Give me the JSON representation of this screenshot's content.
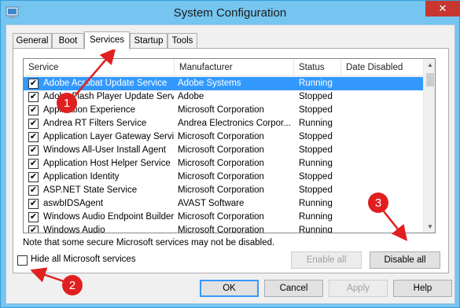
{
  "window": {
    "title": "System Configuration",
    "close_label": "✕"
  },
  "tabs": [
    {
      "label": "General"
    },
    {
      "label": "Boot"
    },
    {
      "label": "Services"
    },
    {
      "label": "Startup"
    },
    {
      "label": "Tools"
    }
  ],
  "active_tab": "Services",
  "columns": {
    "service": "Service",
    "manufacturer": "Manufacturer",
    "status": "Status",
    "date_disabled": "Date Disabled"
  },
  "services": [
    {
      "name": "Adobe Acrobat Update Service",
      "manufacturer": "Adobe Systems",
      "status": "Running",
      "date": "",
      "checked": true,
      "selected": true
    },
    {
      "name": "Adobe Flash Player Update Service",
      "manufacturer": "Adobe",
      "status": "Stopped",
      "date": "",
      "checked": true
    },
    {
      "name": "Application Experience",
      "manufacturer": "Microsoft Corporation",
      "status": "Stopped",
      "date": "",
      "checked": true
    },
    {
      "name": "Andrea RT Filters Service",
      "manufacturer": "Andrea Electronics Corpor...",
      "status": "Running",
      "date": "",
      "checked": true
    },
    {
      "name": "Application Layer Gateway Service",
      "manufacturer": "Microsoft Corporation",
      "status": "Stopped",
      "date": "",
      "checked": true
    },
    {
      "name": "Windows All-User Install Agent",
      "manufacturer": "Microsoft Corporation",
      "status": "Stopped",
      "date": "",
      "checked": true
    },
    {
      "name": "Application Host Helper Service",
      "manufacturer": "Microsoft Corporation",
      "status": "Running",
      "date": "",
      "checked": true
    },
    {
      "name": "Application Identity",
      "manufacturer": "Microsoft Corporation",
      "status": "Stopped",
      "date": "",
      "checked": true
    },
    {
      "name": "ASP.NET State Service",
      "manufacturer": "Microsoft Corporation",
      "status": "Stopped",
      "date": "",
      "checked": true
    },
    {
      "name": "aswbIDSAgent",
      "manufacturer": "AVAST Software",
      "status": "Running",
      "date": "",
      "checked": true
    },
    {
      "name": "Windows Audio Endpoint Builder",
      "manufacturer": "Microsoft Corporation",
      "status": "Running",
      "date": "",
      "checked": true
    },
    {
      "name": "Windows Audio",
      "manufacturer": "Microsoft Corporation",
      "status": "Running",
      "date": "",
      "checked": true
    }
  ],
  "note": "Note that some secure Microsoft services may not be disabled.",
  "buttons": {
    "enable_all": "Enable all",
    "disable_all": "Disable all",
    "ok": "OK",
    "cancel": "Cancel",
    "apply": "Apply",
    "help": "Help"
  },
  "hide_ms": {
    "label": "Hide all Microsoft services",
    "checked": false
  },
  "markers": [
    "1",
    "2",
    "3"
  ],
  "colors": {
    "marker_fill": "#e02020",
    "selection": "#3399ff",
    "titlebar": "#75c5f0",
    "close_button": "#c7372f"
  }
}
